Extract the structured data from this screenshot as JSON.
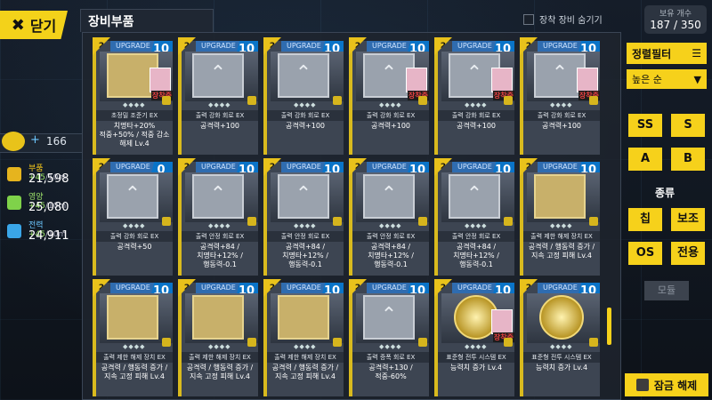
{
  "header": {
    "close_label": "닫기",
    "title": "장비부품",
    "hide_equipped_label": "장착 장비 숨기기",
    "capacity_label": "보유 개수",
    "capacity_value": "187 / 350"
  },
  "resources": {
    "power_value": "166",
    "parts": {
      "label": "부품",
      "rate": "+45",
      "per": "/10m",
      "value": "21,598"
    },
    "nutrition": {
      "label": "영양",
      "rate": "+45",
      "per": "/10m",
      "value": "25,080"
    },
    "power": {
      "label": "전력",
      "rate": "+45",
      "per": "/10m",
      "value": "24,911"
    }
  },
  "filters": {
    "sort_filter": "정렬필터",
    "sort_order": "높은 순",
    "grades": [
      "SS",
      "S",
      "A",
      "B"
    ],
    "kind_label": "종류",
    "kinds": [
      "칩",
      "보조",
      "OS",
      "전용"
    ],
    "all_label": "모듈",
    "lock_release": "잠금 해제"
  },
  "card_common": {
    "upgrade": "UPGRADE",
    "dbl": "2",
    "equipped": "장착중",
    "stars": "◆◆◆◆"
  },
  "cards": [
    {
      "level": "10",
      "name": "초정밀 조준기 EX",
      "stat": "치명타+20%\n적중+50% / 적중 감소\n해제 Lv.4",
      "equipped": true,
      "kind": "scope"
    },
    {
      "level": "10",
      "name": "출력 강화 회로 EX",
      "stat": "공격력+100",
      "equipped": false,
      "kind": "chip"
    },
    {
      "level": "10",
      "name": "출력 강화 회로 EX",
      "stat": "공격력+100",
      "equipped": false,
      "kind": "chip"
    },
    {
      "level": "10",
      "name": "출력 강화 회로 EX",
      "stat": "공격력+100",
      "equipped": true,
      "kind": "chip"
    },
    {
      "level": "10",
      "name": "출력 강화 회로 EX",
      "stat": "공격력+100",
      "equipped": true,
      "kind": "chip"
    },
    {
      "level": "10",
      "name": "출력 강화 회로 EX",
      "stat": "공격력+100",
      "equipped": true,
      "kind": "chip"
    },
    {
      "level": "0",
      "name": "출력 강화 회로 EX",
      "stat": "공격력+50",
      "equipped": false,
      "kind": "chip"
    },
    {
      "level": "10",
      "name": "출력 안정 회로 EX",
      "stat": "공격력+84 /\n치명타+12% /\n행동력-0.1",
      "equipped": false,
      "kind": "chip"
    },
    {
      "level": "10",
      "name": "출력 안정 회로 EX",
      "stat": "공격력+84 /\n치명타+12% /\n행동력-0.1",
      "equipped": false,
      "kind": "chip"
    },
    {
      "level": "10",
      "name": "출력 안정 회로 EX",
      "stat": "공격력+84 /\n치명타+12% /\n행동력-0.1",
      "equipped": false,
      "kind": "chip"
    },
    {
      "level": "10",
      "name": "출력 안정 회로 EX",
      "stat": "공격력+84 /\n치명타+12% /\n행동력-0.1",
      "equipped": false,
      "kind": "chip"
    },
    {
      "level": "10",
      "name": "출력 제한 해제 장치 EX",
      "stat": "공격력 / 행동력 증가 /\n지속 고정 피해 Lv.4",
      "equipped": false,
      "kind": "device"
    },
    {
      "level": "10",
      "name": "출력 제한 해제 장치 EX",
      "stat": "공격력 / 행동력 증가 /\n지속 고정 피해 Lv.4",
      "equipped": false,
      "kind": "device"
    },
    {
      "level": "10",
      "name": "출력 제한 해제 장치 EX",
      "stat": "공격력 / 행동력 증가 /\n지속 고정 피해 Lv.4",
      "equipped": false,
      "kind": "device"
    },
    {
      "level": "10",
      "name": "출력 제한 해제 장치 EX",
      "stat": "공격력 / 행동력 증가 /\n지속 고정 피해 Lv.4",
      "equipped": false,
      "kind": "device"
    },
    {
      "level": "10",
      "name": "출력 증폭 회로 EX",
      "stat": "공격력+130 /\n적중-60%",
      "equipped": false,
      "kind": "chip"
    },
    {
      "level": "10",
      "name": "표준형 전투 시스템 EX",
      "stat": "능력치 증가 Lv.4",
      "equipped": true,
      "kind": "os"
    },
    {
      "level": "10",
      "name": "표준형 전투 시스템 EX",
      "stat": "능력치 증가 Lv.4",
      "equipped": false,
      "kind": "os"
    }
  ]
}
